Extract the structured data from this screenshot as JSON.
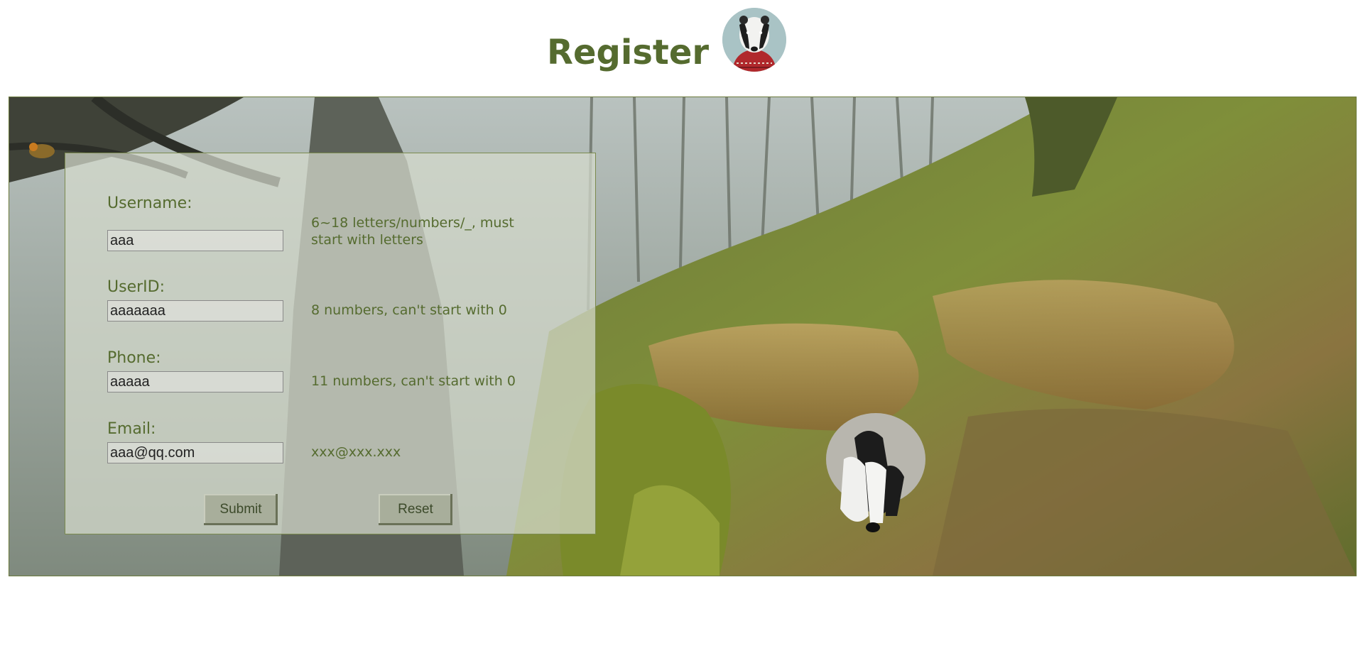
{
  "header": {
    "title": "Register",
    "avatar_icon": "badger-avatar-icon"
  },
  "form": {
    "fields": [
      {
        "label": "Username:",
        "value": "aaa",
        "hint": "6~18 letters/numbers/_, must start with letters"
      },
      {
        "label": "UserID:",
        "value": "aaaaaaa",
        "hint": "8 numbers, can't start with 0"
      },
      {
        "label": "Phone:",
        "value": "aaaaa",
        "hint": "11 numbers, can't start with 0"
      },
      {
        "label": "Email:",
        "value": "aaa@qq.com",
        "hint": "xxx@xxx.xxx"
      }
    ],
    "submit_label": "Submit",
    "reset_label": "Reset"
  },
  "colors": {
    "accent": "#556b2f",
    "panel": "#d6dbcd",
    "button": "#a8ae9b"
  }
}
